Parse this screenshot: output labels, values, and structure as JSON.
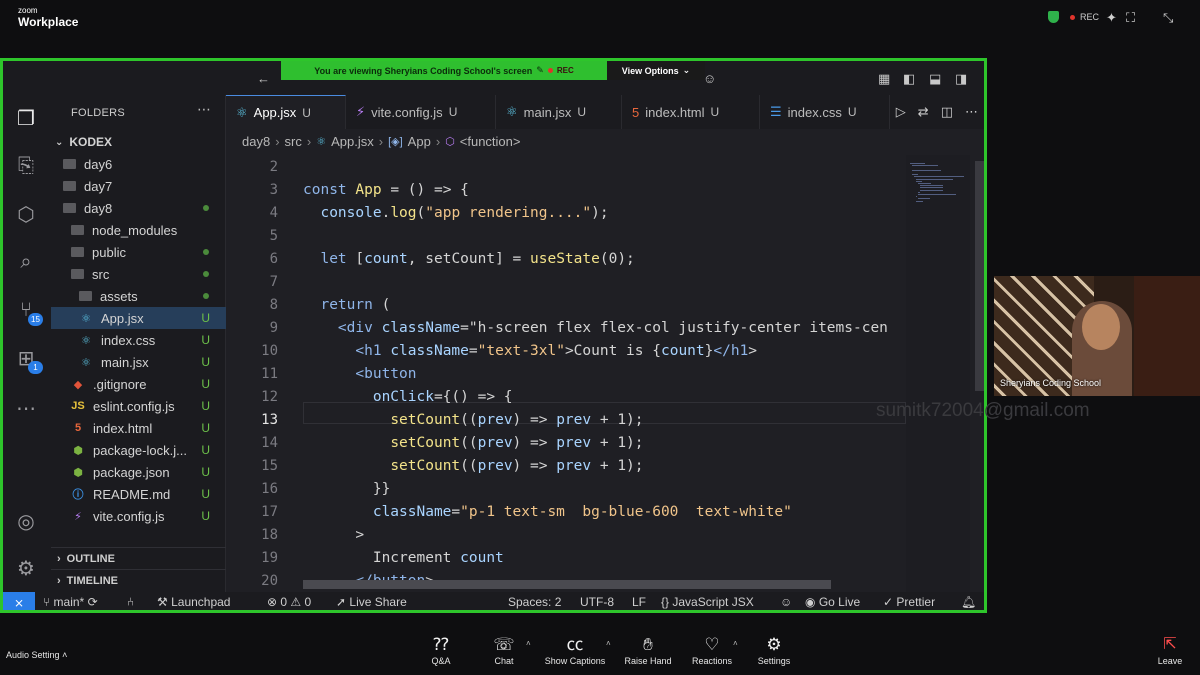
{
  "zoom": {
    "brand_small": "zoom",
    "brand_large": "Workplace",
    "rec_label": "REC",
    "banner_text": "You are viewing  Sheryians Coding School's screen",
    "banner_rec": "REC",
    "view_options": "View Options",
    "audio_setting": "Audio Setting",
    "controls": [
      {
        "label": "Q&A",
        "icon": "qa-icon"
      },
      {
        "label": "Chat",
        "icon": "chat-icon"
      },
      {
        "label": "Show Captions",
        "icon": "captions-icon"
      },
      {
        "label": "Raise Hand",
        "icon": "raise-hand-icon"
      },
      {
        "label": "Reactions",
        "icon": "reactions-icon"
      },
      {
        "label": "Settings",
        "icon": "settings-icon"
      }
    ],
    "leave": "Leave",
    "webcam_name": "Sheryians Coding School",
    "watermark": "sumitk72004@gmail.com",
    "colors": {
      "share_border": "#2ec52b",
      "leave": "#ff4d4d",
      "rec_dot": "#e0342c"
    }
  },
  "vscode": {
    "title_partial": "kodex",
    "sidebar": {
      "header": "FOLDERS",
      "root": "KODEX",
      "items": [
        {
          "name": "day6",
          "kind": "folder",
          "status": ""
        },
        {
          "name": "day7",
          "kind": "folder",
          "status": ""
        },
        {
          "name": "day8",
          "kind": "folder",
          "status": "dot"
        },
        {
          "name": "node_modules",
          "kind": "folder",
          "status": ""
        },
        {
          "name": "public",
          "kind": "folder",
          "status": "dot"
        },
        {
          "name": "src",
          "kind": "folder",
          "status": "dot"
        },
        {
          "name": "assets",
          "kind": "folder",
          "status": "dot"
        },
        {
          "name": "App.jsx",
          "kind": "react",
          "status": "U"
        },
        {
          "name": "index.css",
          "kind": "react",
          "status": "U"
        },
        {
          "name": "main.jsx",
          "kind": "react",
          "status": "U"
        },
        {
          "name": ".gitignore",
          "kind": "git",
          "status": "U"
        },
        {
          "name": "eslint.config.js",
          "kind": "js",
          "status": "U"
        },
        {
          "name": "index.html",
          "kind": "html",
          "status": "U"
        },
        {
          "name": "package-lock.j...",
          "kind": "node",
          "status": "U"
        },
        {
          "name": "package.json",
          "kind": "node",
          "status": "U"
        },
        {
          "name": "README.md",
          "kind": "info",
          "status": "U"
        },
        {
          "name": "vite.config.js",
          "kind": "vite",
          "status": "U"
        }
      ],
      "outline": "OUTLINE",
      "timeline": "TIMELINE",
      "scm_badge": "15",
      "ext_badge": "1"
    },
    "tabs": [
      {
        "label": "App.jsx",
        "status": "U",
        "active": true
      },
      {
        "label": "vite.config.js",
        "status": "U",
        "active": false
      },
      {
        "label": "main.jsx",
        "status": "U",
        "active": false
      },
      {
        "label": "index.html",
        "status": "U",
        "active": false
      },
      {
        "label": "index.css",
        "status": "U",
        "active": false
      }
    ],
    "breadcrumb": [
      "day8",
      "src",
      "App.jsx",
      "App",
      "<function>"
    ],
    "code_lines": [
      {
        "n": "2",
        "t": ""
      },
      {
        "n": "3",
        "t": "const App = () => {"
      },
      {
        "n": "4",
        "t": "  console.log(\"app rendering....\");"
      },
      {
        "n": "5",
        "t": ""
      },
      {
        "n": "6",
        "t": "  let [count, setCount] = useState(0);"
      },
      {
        "n": "7",
        "t": ""
      },
      {
        "n": "8",
        "t": "  return ("
      },
      {
        "n": "9",
        "t": "    <div className=\"h-screen flex flex-col justify-center items-cen"
      },
      {
        "n": "10",
        "t": "      <h1 className=\"text-3xl\">Count is {count}</h1>"
      },
      {
        "n": "11",
        "t": "      <button"
      },
      {
        "n": "12",
        "t": "        onClick={() => {"
      },
      {
        "n": "13",
        "t": "          setCount((prev) => prev + 1);"
      },
      {
        "n": "14",
        "t": "          setCount((prev) => prev + 1);"
      },
      {
        "n": "15",
        "t": "          setCount((prev) => prev + 1);"
      },
      {
        "n": "16",
        "t": "        }}"
      },
      {
        "n": "17",
        "t": "        className=\"p-1 text-sm  bg-blue-600  text-white\""
      },
      {
        "n": "18",
        "t": "      >"
      },
      {
        "n": "19",
        "t": "        Increment count"
      },
      {
        "n": "20",
        "t": "      </button>"
      }
    ],
    "current_line": "13",
    "status": {
      "branch": "main*",
      "launchpad": "Launchpad",
      "errors": "0",
      "warnings": "0",
      "live_share": "Live Share",
      "spaces": "Spaces: 2",
      "encoding": "UTF-8",
      "eol": "LF",
      "language": "JavaScript JSX",
      "go_live": "Go Live",
      "prettier": "Prettier"
    }
  }
}
